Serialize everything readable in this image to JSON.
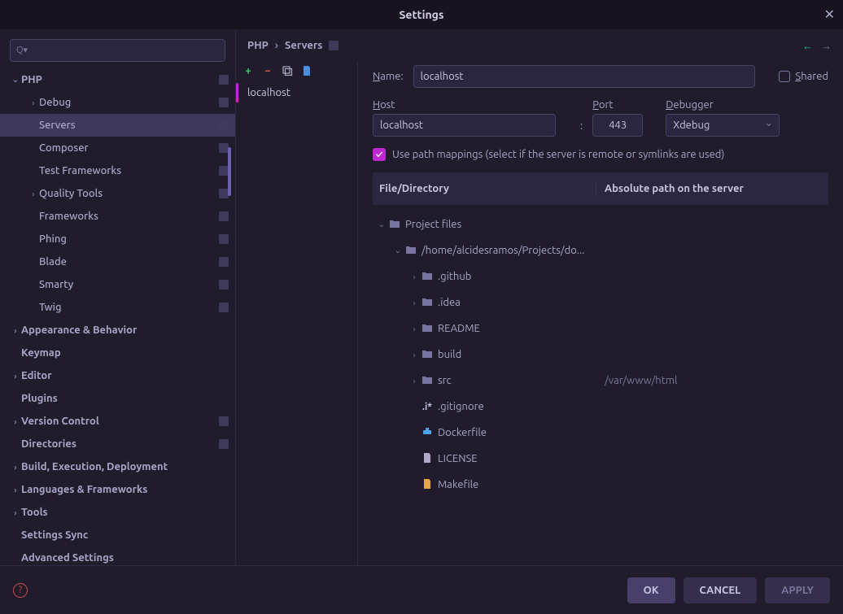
{
  "window": {
    "title": "Settings"
  },
  "search": {
    "placeholder": ""
  },
  "sidebar": {
    "items": [
      {
        "label": "PHP",
        "depth": 0,
        "arrow": "down",
        "badge": true
      },
      {
        "label": "Debug",
        "depth": 1,
        "arrow": "right",
        "badge": true,
        "sub": true
      },
      {
        "label": "Servers",
        "depth": 1,
        "arrow": "",
        "badge": true,
        "sub": true,
        "selected": true
      },
      {
        "label": "Composer",
        "depth": 1,
        "arrow": "",
        "badge": true,
        "sub": true
      },
      {
        "label": "Test Frameworks",
        "depth": 1,
        "arrow": "",
        "badge": true,
        "sub": true
      },
      {
        "label": "Quality Tools",
        "depth": 1,
        "arrow": "right",
        "badge": true,
        "sub": true
      },
      {
        "label": "Frameworks",
        "depth": 1,
        "arrow": "",
        "badge": true,
        "sub": true
      },
      {
        "label": "Phing",
        "depth": 1,
        "arrow": "",
        "badge": true,
        "sub": true
      },
      {
        "label": "Blade",
        "depth": 1,
        "arrow": "",
        "badge": true,
        "sub": true
      },
      {
        "label": "Smarty",
        "depth": 1,
        "arrow": "",
        "badge": true,
        "sub": true
      },
      {
        "label": "Twig",
        "depth": 1,
        "arrow": "",
        "badge": true,
        "sub": true
      },
      {
        "label": "Appearance & Behavior",
        "depth": 0,
        "arrow": "right",
        "badge": false
      },
      {
        "label": "Keymap",
        "depth": 0,
        "arrow": "",
        "badge": false
      },
      {
        "label": "Editor",
        "depth": 0,
        "arrow": "right",
        "badge": false
      },
      {
        "label": "Plugins",
        "depth": 0,
        "arrow": "",
        "badge": false
      },
      {
        "label": "Version Control",
        "depth": 0,
        "arrow": "right",
        "badge": true
      },
      {
        "label": "Directories",
        "depth": 0,
        "arrow": "",
        "badge": true
      },
      {
        "label": "Build, Execution, Deployment",
        "depth": 0,
        "arrow": "right",
        "badge": false
      },
      {
        "label": "Languages & Frameworks",
        "depth": 0,
        "arrow": "right",
        "badge": false
      },
      {
        "label": "Tools",
        "depth": 0,
        "arrow": "right",
        "badge": false
      },
      {
        "label": "Settings Sync",
        "depth": 0,
        "arrow": "",
        "badge": false
      },
      {
        "label": "Advanced Settings",
        "depth": 0,
        "arrow": "",
        "badge": false
      }
    ]
  },
  "breadcrumb": {
    "parent": "PHP",
    "current": "Servers"
  },
  "server_list": {
    "items": [
      {
        "label": "localhost",
        "active": true
      }
    ]
  },
  "form": {
    "name_label": "Name:",
    "name_value": "localhost",
    "shared_label": "Shared",
    "host_label": "Host",
    "host_value": "localhost",
    "port_label": "Port",
    "port_value": "443",
    "debugger_label": "Debugger",
    "debugger_value": "Xdebug",
    "use_path_mappings_label": "Use path mappings (select if the server is remote or symlinks are used)",
    "col_file": "File/Directory",
    "col_abs": "Absolute path on the server"
  },
  "mappings": [
    {
      "depth": 0,
      "arrow": "down",
      "icon": "folder",
      "label": "Project files",
      "abs": ""
    },
    {
      "depth": 1,
      "arrow": "down",
      "icon": "folder",
      "label": "/home/alcidesramos/Projects/do...",
      "abs": ""
    },
    {
      "depth": 2,
      "arrow": "right",
      "icon": "folder",
      "label": ".github",
      "abs": ""
    },
    {
      "depth": 2,
      "arrow": "right",
      "icon": "folder",
      "label": ".idea",
      "abs": ""
    },
    {
      "depth": 2,
      "arrow": "right",
      "icon": "folder",
      "label": "README",
      "abs": ""
    },
    {
      "depth": 2,
      "arrow": "right",
      "icon": "folder",
      "label": "build",
      "abs": ""
    },
    {
      "depth": 2,
      "arrow": "right",
      "icon": "folder",
      "label": "src",
      "abs": "/var/www/html"
    },
    {
      "depth": 2,
      "arrow": "",
      "icon": "gitignore",
      "label": ".gitignore",
      "abs": ""
    },
    {
      "depth": 2,
      "arrow": "",
      "icon": "docker",
      "label": "Dockerfile",
      "abs": ""
    },
    {
      "depth": 2,
      "arrow": "",
      "icon": "file",
      "label": "LICENSE",
      "abs": ""
    },
    {
      "depth": 2,
      "arrow": "",
      "icon": "make",
      "label": "Makefile",
      "abs": ""
    }
  ],
  "buttons": {
    "ok": "OK",
    "cancel": "CANCEL",
    "apply": "APPLY"
  }
}
